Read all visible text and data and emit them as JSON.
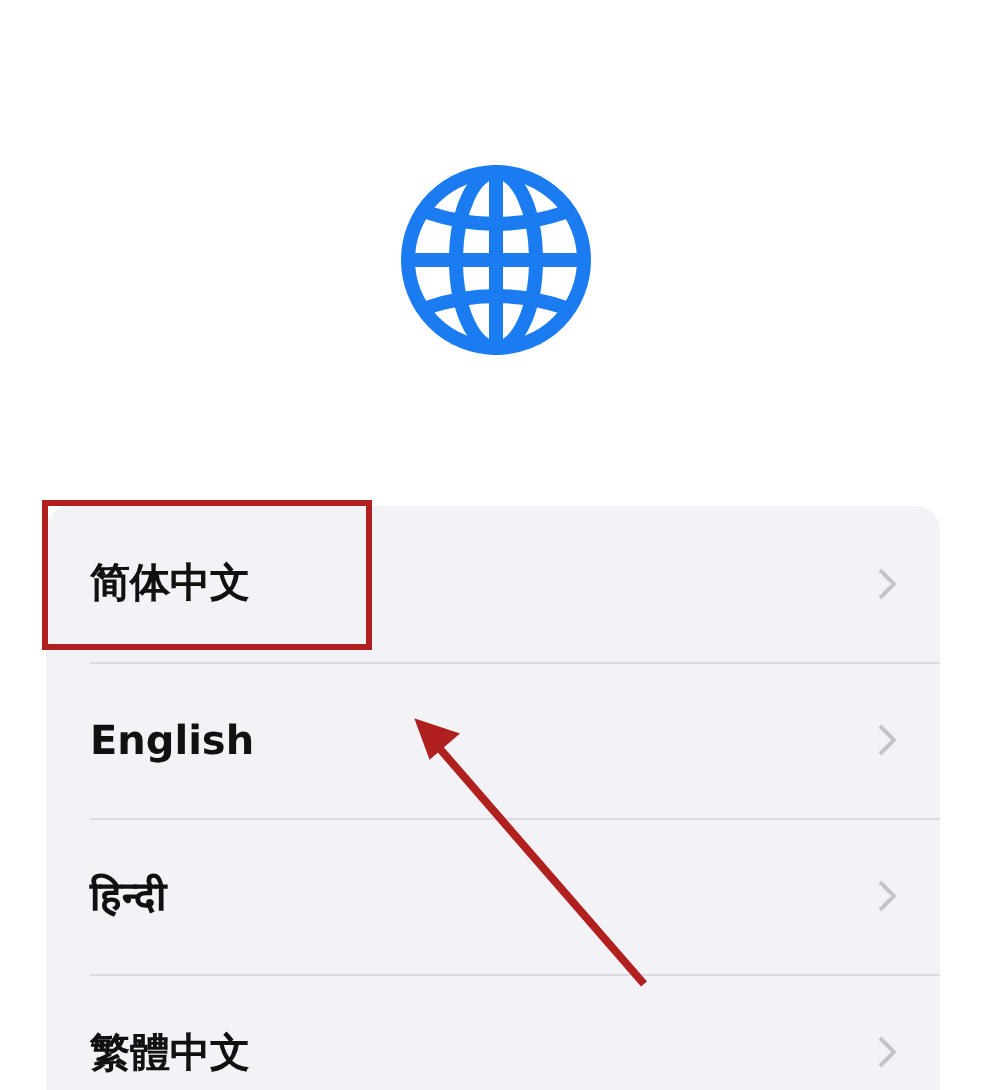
{
  "languages": [
    {
      "label": "简体中文",
      "highlighted": true
    },
    {
      "label": "English",
      "highlighted": false
    },
    {
      "label": "हिन्दी",
      "highlighted": false
    },
    {
      "label": "繁體中文",
      "highlighted": false
    }
  ]
}
